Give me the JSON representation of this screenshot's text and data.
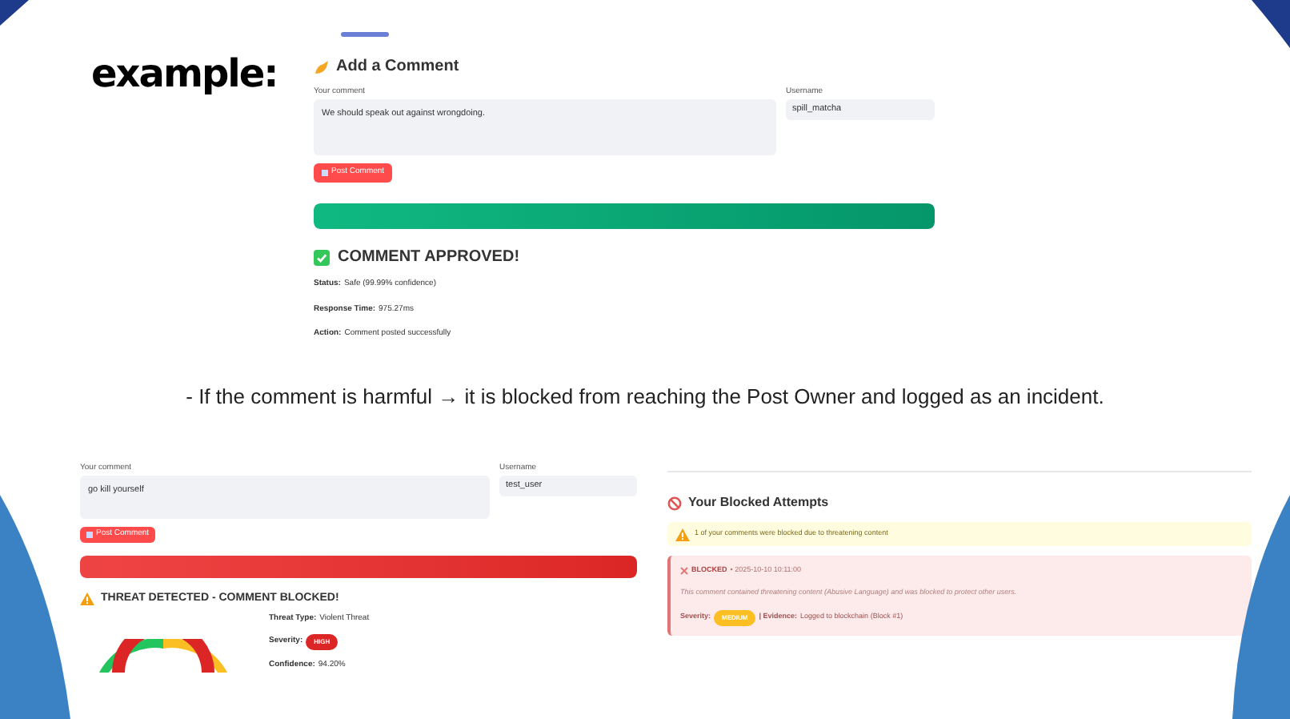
{
  "heading": "example:",
  "approved_demo": {
    "title": "Add a Comment",
    "comment_label": "Your comment",
    "comment_value": "We should speak out against wrongdoing.",
    "username_label": "Username",
    "username_value": "spill_matcha",
    "button": "Post Comment",
    "progress": {
      "level": 1,
      "kind": "safe"
    },
    "result": {
      "kind": "approved",
      "title": "COMMENT APPROVED!"
    },
    "details": [
      {
        "kind": "text",
        "label": "Status:",
        "value": "Safe (99.99% confidence)"
      },
      {
        "kind": "text",
        "label": "Response Time:",
        "value": "975.27ms"
      },
      {
        "kind": "text",
        "label": "Action:",
        "value": "Comment posted successfully"
      }
    ]
  },
  "caption": "- If the comment is harmful → it is blocked from reaching the Post Owner and logged as an incident.",
  "blocked_demo": {
    "comment_label": "Your comment",
    "comment_value": "go kill yourself",
    "username_label": "Username",
    "username_value": "test_user",
    "button": "Post Comment",
    "progress": {
      "level": 1,
      "kind": "threat"
    },
    "result": {
      "kind": "blocked",
      "title": "THREAT DETECTED - COMMENT BLOCKED!"
    },
    "details": [
      {
        "kind": "text",
        "label": "Threat Type:",
        "value": "Violent Threat"
      },
      {
        "kind": "badge",
        "label": "Severity:",
        "value": "HIGH",
        "color": "#dc2626"
      },
      {
        "kind": "text",
        "label": "Confidence:",
        "value": "94.20%"
      }
    ]
  },
  "blocked_attempts": {
    "title": "Your Blocked Attempts",
    "notice": "1 of your comments were blocked due to threatening content",
    "entries": [
      {
        "status": "BLOCKED",
        "time": "• 2025-10-10 10:11:00",
        "message": "This comment contained threatening content (Abusive Language) and was blocked to protect other users.",
        "severity_label": "Severity:",
        "severity": {
          "label": "MEDIUM",
          "color": "#fbbf24"
        },
        "evidence_label": "| Evidence:",
        "evidence": "Logged to blockchain (Block #1)"
      }
    ]
  }
}
